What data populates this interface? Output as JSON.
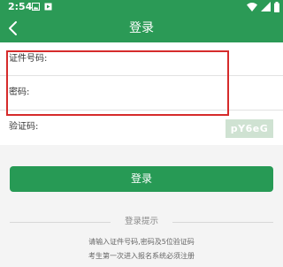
{
  "status_bar": {
    "time": "2:54"
  },
  "app_bar": {
    "title": "登录"
  },
  "form": {
    "id_label": "证件号码:",
    "id_value": "",
    "password_label": "密码:",
    "password_value": "",
    "captcha_label": "验证码:",
    "captcha_value": "",
    "captcha_image_text": "pY6eG"
  },
  "login_button": {
    "label": "登录"
  },
  "hints": {
    "title": "登录提示",
    "line1": "请输入证件号码,密码及5位验证码",
    "line2": "考生第一次进入报名系统必须注册"
  },
  "colors": {
    "brand_green": "#2b9a56",
    "highlight_red": "#d62b2b"
  }
}
